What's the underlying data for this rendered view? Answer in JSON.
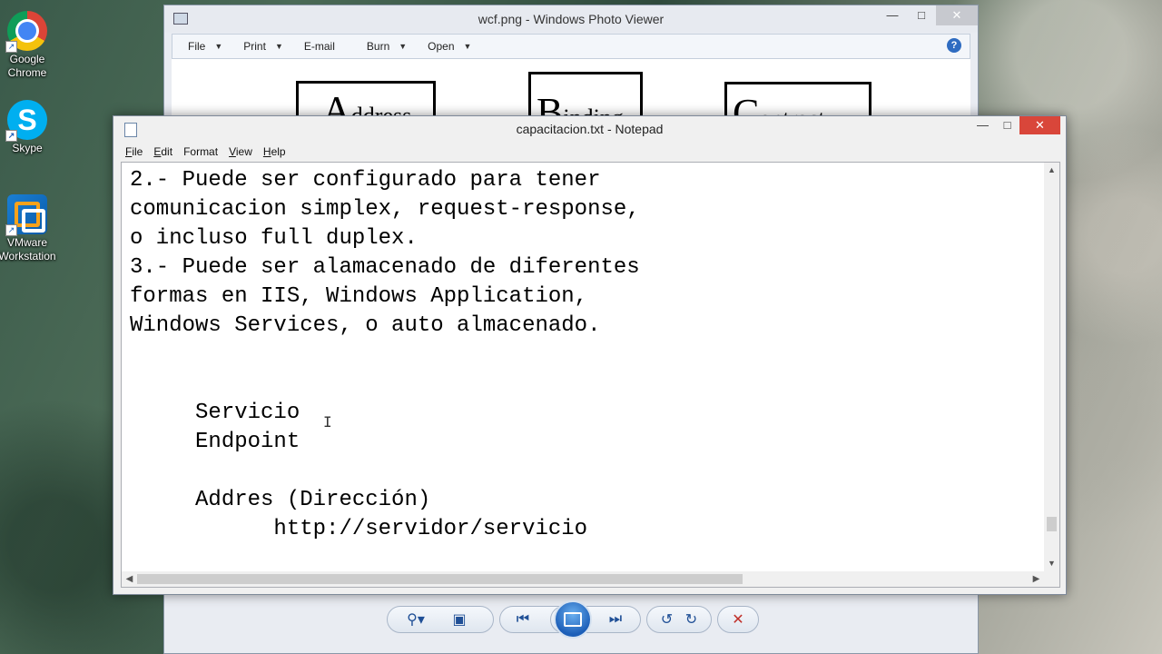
{
  "desktop": {
    "icons": [
      {
        "label": "Google Chrome",
        "line1": "Google",
        "line2": "Chrome",
        "icon": "chrome-icon"
      },
      {
        "label": "Skype",
        "line1": "Skype",
        "line2": "",
        "icon": "skype-icon"
      },
      {
        "label": "VMware Workstation",
        "line1": "VMware",
        "line2": "Workstation",
        "icon": "vmware-icon"
      }
    ]
  },
  "photo_viewer": {
    "title": "wcf.png - Windows Photo Viewer",
    "menu": [
      "File",
      "Print",
      "E-mail",
      "Burn",
      "Open"
    ],
    "image_boxes": [
      {
        "initial": "A",
        "rest": "ddress"
      },
      {
        "initial": "B",
        "rest": "inding"
      },
      {
        "initial": "C",
        "rest": "ontract"
      }
    ],
    "toolbar_icons": [
      "zoom-icon",
      "actual-size-icon",
      "previous-icon",
      "slideshow-icon",
      "next-icon",
      "rotate-left-icon",
      "rotate-right-icon",
      "delete-icon"
    ]
  },
  "notepad": {
    "title": "capacitacion.txt - Notepad",
    "menu": {
      "file": {
        "accel": "F",
        "rest": "ile"
      },
      "edit": {
        "accel": "E",
        "rest": "dit"
      },
      "format": {
        "accel": "F",
        "rest": "ormat",
        "prefix": "",
        "label": "Format"
      },
      "view": {
        "accel": "V",
        "rest": "iew"
      },
      "help": {
        "accel": "H",
        "rest": "elp"
      }
    },
    "content": "2.- Puede ser configurado para tener\ncomunicacion simplex, request-response,\no incluso full duplex.\n3.- Puede ser alamacenado de diferentes\nformas en IIS, Windows Application,\nWindows Services, o auto almacenado.\n\n\n     Servicio\n     Endpoint\n\n     Addres (Dirección)\n           http://servidor/servicio"
  }
}
